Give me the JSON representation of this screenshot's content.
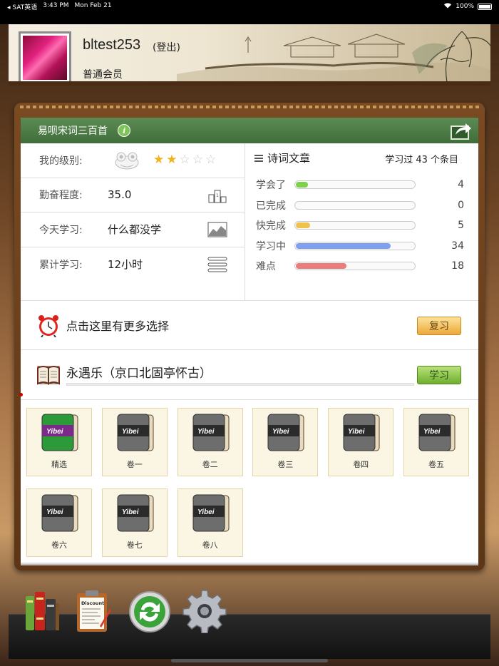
{
  "status_bar": {
    "back_app": "◂ SAT英语",
    "time": "3:43 PM",
    "date": "Mon Feb 21",
    "battery": "100%"
  },
  "user": {
    "name": "bltest253",
    "logout": "(登出)",
    "membership": "普通会员"
  },
  "course": {
    "title": "易呗宋词三百首"
  },
  "stats": {
    "level_label": "我的级别:",
    "level_stars": 2,
    "level_max": 5,
    "diligence_label": "勤奋程度:",
    "diligence_value": "35.0",
    "today_label": "今天学习:",
    "today_value": "什么都没学",
    "total_label": "累计学习:",
    "total_value": "12小时"
  },
  "progress": {
    "heading": "诗词文章",
    "summary": "学习过 43 个条目",
    "items": [
      {
        "label": "学会了",
        "value": "4",
        "fraction": 0.1,
        "color": "#7ed24a"
      },
      {
        "label": "已完成",
        "value": "0",
        "fraction": 0.0,
        "color": "#cccccc"
      },
      {
        "label": "快完成",
        "value": "5",
        "fraction": 0.12,
        "color": "#f0c24c"
      },
      {
        "label": "学习中",
        "value": "34",
        "fraction": 0.79,
        "color": "#7f9ff0"
      },
      {
        "label": "难点",
        "value": "18",
        "fraction": 0.42,
        "color": "#ec7b7b"
      }
    ]
  },
  "more": {
    "text": "点击这里有更多选择",
    "review_button": "复习"
  },
  "study": {
    "poem": "永遇乐（京口北固亭怀古）",
    "study_button": "学习"
  },
  "volumes": [
    {
      "label": "精选",
      "style": "green"
    },
    {
      "label": "卷一",
      "style": "gray"
    },
    {
      "label": "卷二",
      "style": "gray"
    },
    {
      "label": "卷三",
      "style": "gray"
    },
    {
      "label": "卷四",
      "style": "gray"
    },
    {
      "label": "卷五",
      "style": "gray"
    },
    {
      "label": "卷六",
      "style": "gray"
    },
    {
      "label": "卷七",
      "style": "gray"
    },
    {
      "label": "卷八",
      "style": "gray"
    }
  ],
  "book_brand": "Yibei",
  "dock": {
    "clipboard_label": "Discount"
  }
}
